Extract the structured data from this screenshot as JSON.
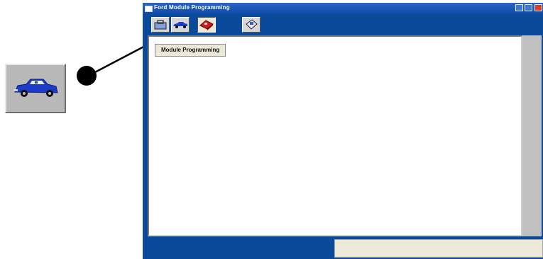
{
  "window": {
    "title": "Ford Module Programming"
  },
  "toolbar": {
    "tools": [
      {
        "icon": "toolbox-icon"
      },
      {
        "icon": "vehicle-icon"
      },
      {
        "icon": "module-programming-icon",
        "pressed": true
      },
      {
        "icon": "disk-icon"
      }
    ],
    "tooltip": "Module Programming"
  },
  "callout": {
    "icon": "vehicle-icon"
  },
  "colors": {
    "window_frame": "#0a4a9a",
    "titlebar": "#1c56b8",
    "tooltip_bg": "#ece9d8",
    "vehicle": "#1a3cc8"
  }
}
